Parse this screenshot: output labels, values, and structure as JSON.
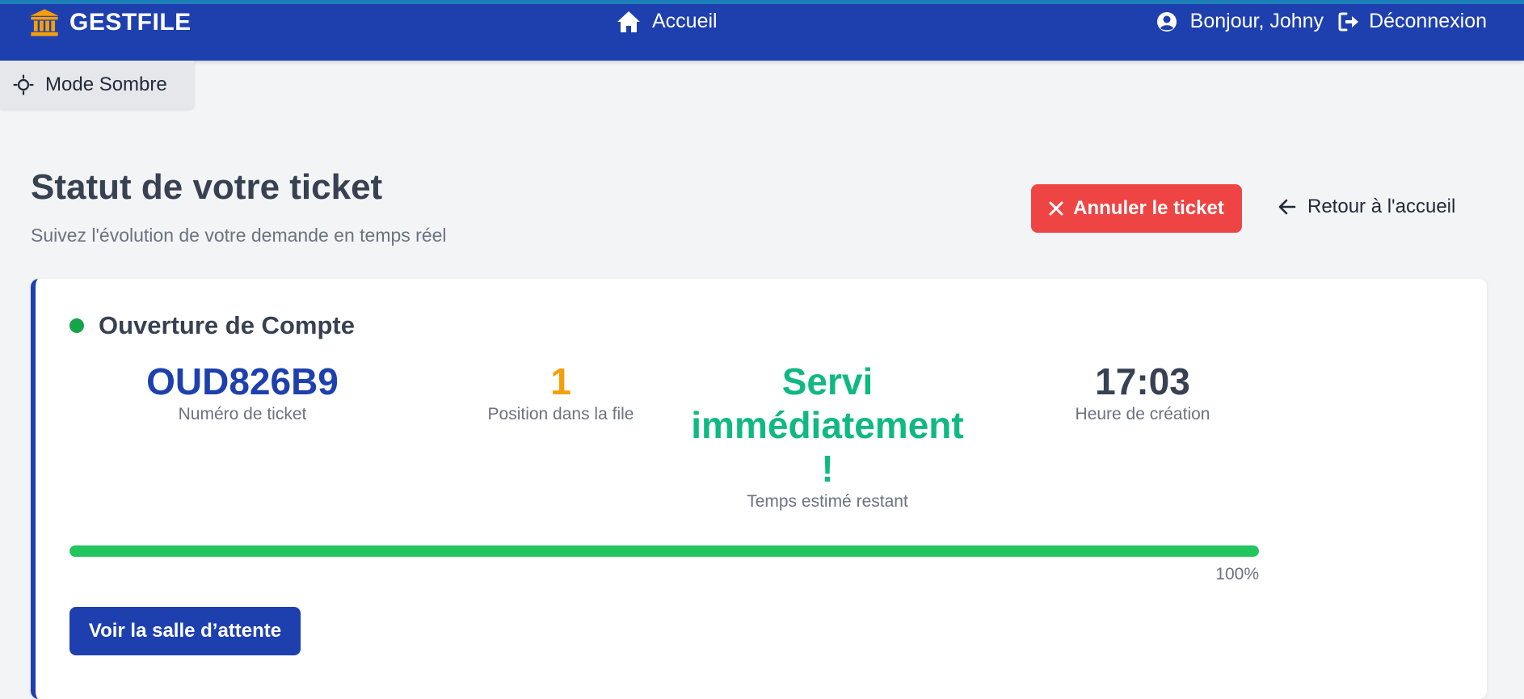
{
  "header": {
    "brand": "GESTFILE",
    "nav_home": "Accueil",
    "greeting": "Bonjour, Johny",
    "logout": "Déconnexion"
  },
  "theme_toggle": {
    "label": "Mode Sombre"
  },
  "page": {
    "title": "Statut de votre ticket",
    "subtitle": "Suivez l'évolution de votre demande en temps réel",
    "cancel_button": "Annuler le ticket",
    "back_link": "Retour à l'accueil"
  },
  "ticket": {
    "service": "Ouverture de Compte",
    "ticket_number": "OUD826B9",
    "ticket_number_label": "Numéro de ticket",
    "position": "1",
    "position_label": "Position dans la file",
    "estimated_time": "Servi immédiatement !",
    "estimated_time_label": "Temps estimé restant",
    "created_time": "17:03",
    "created_time_label": "Heure de création",
    "progress_percent": 100,
    "progress_label": "100%",
    "waiting_room_button": "Voir la salle d’attente"
  },
  "colors": {
    "header_bg": "#1e40af",
    "accent_blue": "#1e40af",
    "danger": "#ef4444",
    "position_orange": "#f59e0b",
    "success_green": "#10b981",
    "progress_green": "#22c55e"
  },
  "icons": {
    "brand": "bank-icon",
    "home": "home-icon",
    "user": "user-circle-icon",
    "logout": "sign-out-icon",
    "theme": "sun-icon",
    "cancel": "close-icon",
    "back": "arrow-left-icon"
  }
}
